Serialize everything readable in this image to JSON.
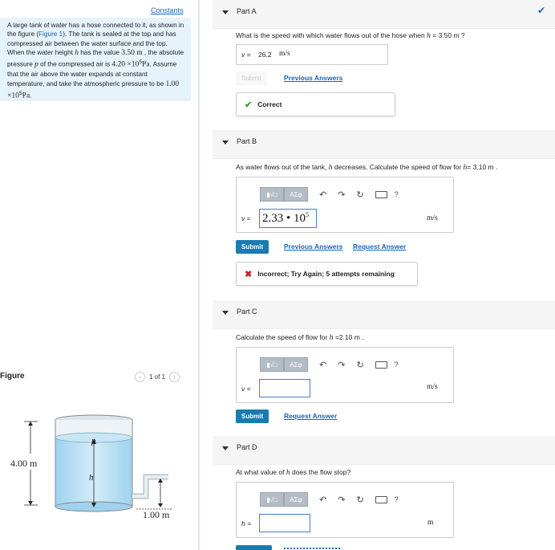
{
  "constants_link": "Constants",
  "problem": {
    "t1": "A large tank of water has a hose connected to it, as shown in the figure (",
    "fig_link": "Figure 1",
    "t2": "). The tank is sealed at the top and has compressed air between the water surface and the top. When the water height ",
    "h": "h",
    "t3": " has the value ",
    "v1": "3.50 m",
    "t4": " , the absolute pressure ",
    "p": "p",
    "t5": " of the compressed air is ",
    "v2": "4.20 ×10",
    "v2exp": "5",
    "v2unit": "Pa",
    "t6": ". Assume that the air above the water expands at constant temperature, and take the atmospheric pressure to be ",
    "v3": "1.00 ×10",
    "v3exp": "5",
    "v3unit": "Pa",
    "t7": "."
  },
  "figure": {
    "label": "Figure",
    "pager": "1 of 1",
    "height_label": "4.00 m",
    "outlet_label": "1.00 m",
    "p_label": "p",
    "h_label": "h"
  },
  "partA": {
    "title": "Part A",
    "question": "What is the speed with which water flows out of the hose when",
    "var": "h",
    "eq": " = 3.50 m ?",
    "answer_var": "v =",
    "answer_value": "26.2",
    "answer_unit": "m/s",
    "submit": "Submit",
    "prev": "Previous Answers",
    "feedback": "Correct",
    "check_color": "#1a66b3"
  },
  "partB": {
    "title": "Part B",
    "question": "As water flows out of the tank,",
    "var": "h",
    "q2": " decreases. Calculate the speed of flow for",
    "var2": "h",
    "eq": "= 3.10 m .",
    "tb_label": "ΑΣφ",
    "answer_var": "v =",
    "answer_mant": "2.33 • 10",
    "answer_exp": "5",
    "answer_unit": "m/s",
    "submit": "Submit",
    "prev": "Previous Answers",
    "request": "Request Answer",
    "feedback": "Incorrect; Try Again; 5 attempts remaining"
  },
  "partC": {
    "title": "Part C",
    "question": "Calculate the speed of flow for",
    "var": "h",
    "eq": " =2.10 m .",
    "tb_label": "ΑΣφ",
    "answer_var": "v =",
    "answer_unit": "m/s",
    "submit": "Submit",
    "request": "Request Answer"
  },
  "partD": {
    "title": "Part D",
    "question": "At what value of",
    "var": "h",
    "q2": " does the flow stop?",
    "tb_label": "ΑΣφ",
    "answer_var": "h =",
    "answer_unit": "m"
  },
  "toolbar_icons": [
    "template-icon",
    "greek-icon",
    "undo-icon",
    "redo-icon",
    "reset-icon",
    "keyboard-icon",
    "help-icon"
  ]
}
